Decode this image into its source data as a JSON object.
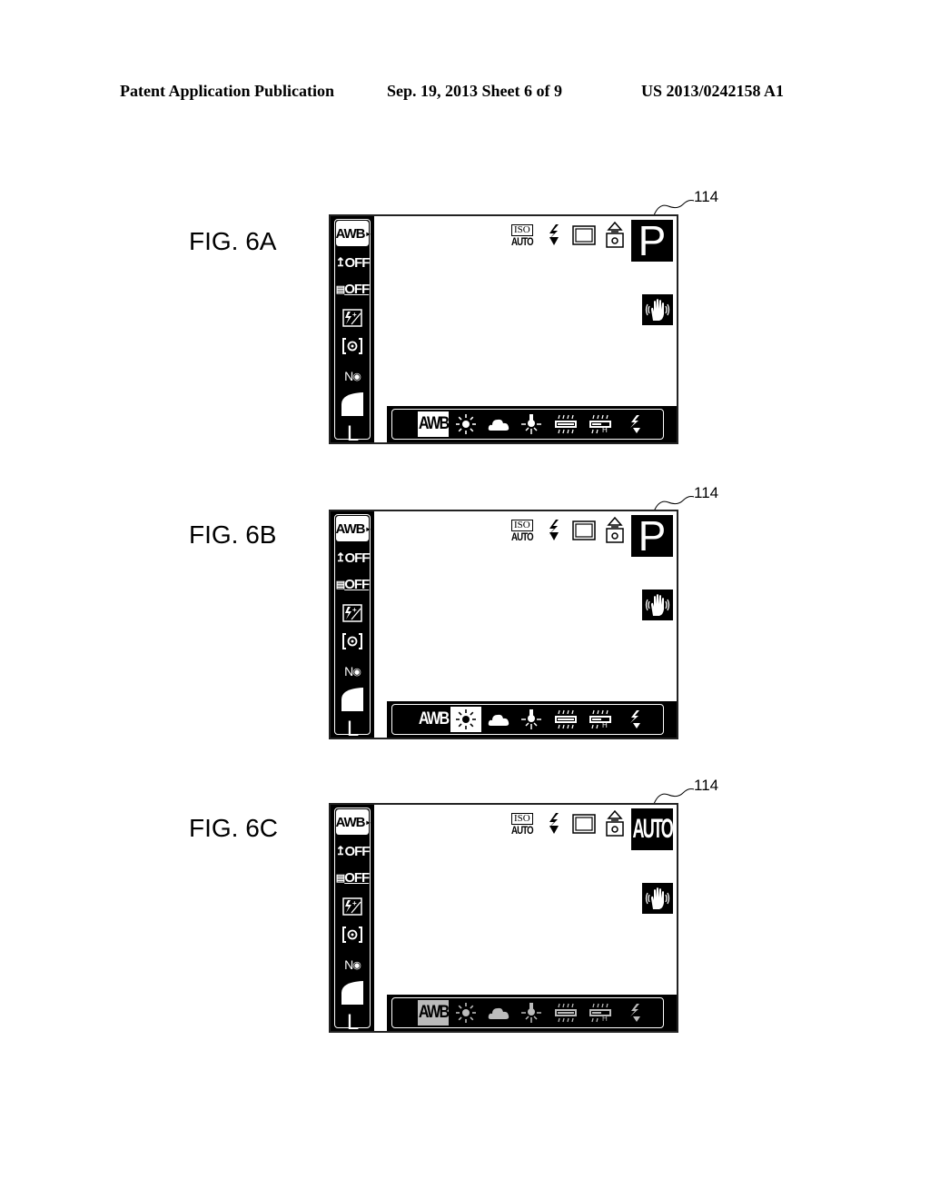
{
  "header": {
    "publication": "Patent Application Publication",
    "date_sheet": "Sep. 19, 2013   Sheet 6 of 9",
    "patent_number": "US 2013/0242158 A1"
  },
  "figures": [
    {
      "label": "FIG. 6A",
      "ref": "114",
      "mode_label": "P",
      "left_menu": [
        "AWB",
        "OFF",
        "OFF",
        "±Z",
        "metering",
        "N",
        "quality",
        "L"
      ],
      "top_icons": [
        "iso-auto",
        "flash",
        "frame",
        "self-timer"
      ],
      "iso_top": "ISO",
      "iso_bottom": "AUTO",
      "wb_bar": {
        "items": [
          "AWB",
          "daylight",
          "cloudy",
          "tungsten",
          "fluorescent",
          "fluorescent-h",
          "flash"
        ],
        "selected": "AWB",
        "state": "active"
      }
    },
    {
      "label": "FIG. 6B",
      "ref": "114",
      "mode_label": "P",
      "left_menu": [
        "AWB",
        "OFF",
        "OFF",
        "±Z",
        "metering",
        "N",
        "quality",
        "L"
      ],
      "top_icons": [
        "iso-auto",
        "flash",
        "frame",
        "self-timer"
      ],
      "iso_top": "ISO",
      "iso_bottom": "AUTO",
      "wb_bar": {
        "items": [
          "AWB",
          "daylight",
          "cloudy",
          "tungsten",
          "fluorescent",
          "fluorescent-h",
          "flash"
        ],
        "selected": "daylight",
        "state": "active"
      }
    },
    {
      "label": "FIG. 6C",
      "ref": "114",
      "mode_label": "AUTO",
      "left_menu": [
        "AWB",
        "OFF",
        "OFF",
        "±Z",
        "metering",
        "N",
        "quality",
        "L"
      ],
      "top_icons": [
        "iso-auto",
        "flash",
        "frame",
        "self-timer"
      ],
      "iso_top": "ISO",
      "iso_bottom": "AUTO",
      "wb_bar": {
        "items": [
          "AWB",
          "daylight",
          "cloudy",
          "tungsten",
          "fluorescent",
          "fluorescent-h",
          "flash"
        ],
        "selected": "AWB",
        "state": "disabled"
      }
    }
  ],
  "left_menu_text": {
    "awb": "AWB",
    "off": "OFF",
    "l": "L",
    "n": "N"
  },
  "colors": {
    "ink": "#000000",
    "paper": "#ffffff",
    "disabled": "#bbbbbb"
  }
}
